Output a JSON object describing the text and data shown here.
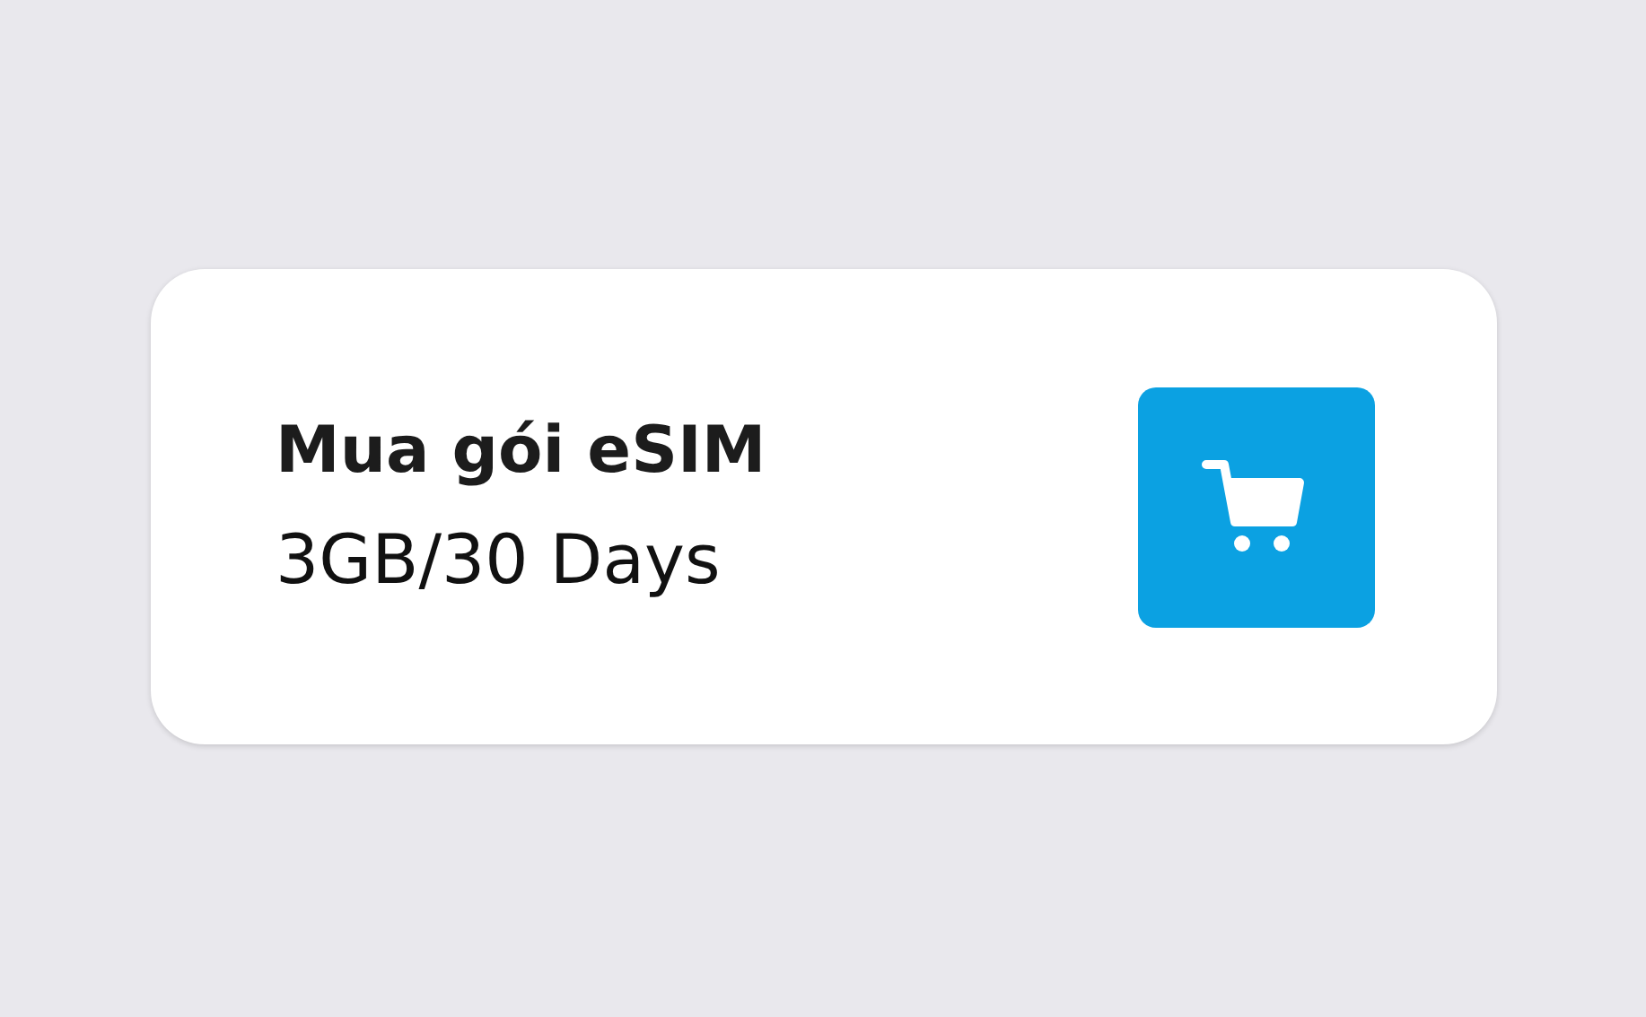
{
  "card": {
    "title": "Mua gói eSIM",
    "subtitle": "3GB/30 Days"
  }
}
